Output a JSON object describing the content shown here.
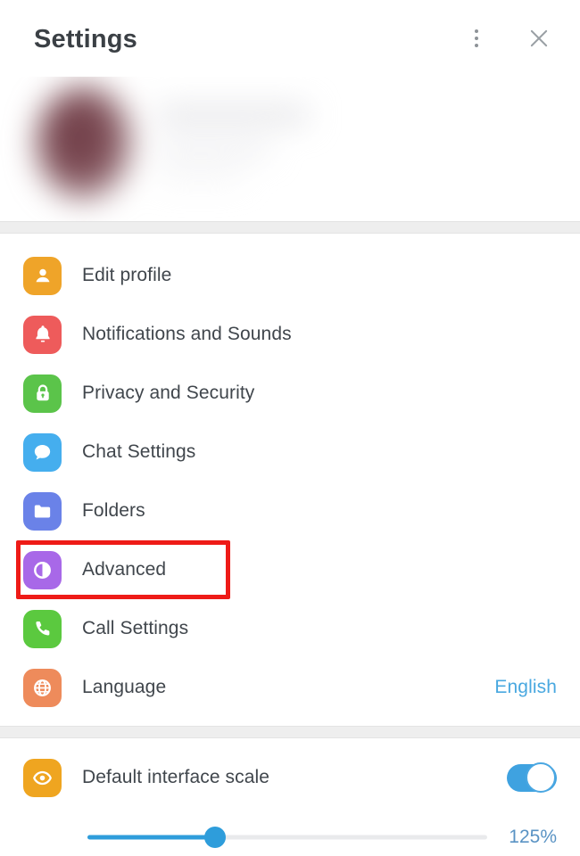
{
  "header": {
    "title": "Settings",
    "menu_icon": "more-vertical-icon",
    "close_icon": "close-icon"
  },
  "profile": {
    "blurred": true,
    "avatar_icon": "blurred-avatar"
  },
  "menu": {
    "items": [
      {
        "label": "Edit profile",
        "icon": "person-icon",
        "color": "#efa429",
        "value": ""
      },
      {
        "label": "Notifications and Sounds",
        "icon": "bell-icon",
        "color": "#ee5b5b",
        "value": ""
      },
      {
        "label": "Privacy and Security",
        "icon": "lock-icon",
        "color": "#5bc44a",
        "value": ""
      },
      {
        "label": "Chat Settings",
        "icon": "chat-bubble-icon",
        "color": "#45aeee",
        "value": ""
      },
      {
        "label": "Folders",
        "icon": "folder-icon",
        "color": "#6a82e8",
        "value": ""
      },
      {
        "label": "Advanced",
        "icon": "contrast-icon",
        "color": "#a868e8",
        "value": ""
      },
      {
        "label": "Call Settings",
        "icon": "phone-icon",
        "color": "#5bc93f",
        "value": ""
      },
      {
        "label": "Language",
        "icon": "globe-icon",
        "color": "#ee8b5b",
        "value": "English"
      }
    ]
  },
  "highlight": {
    "target_label": "Advanced",
    "color": "#ee1b17"
  },
  "scale": {
    "label": "Default interface scale",
    "icon": "eye-icon",
    "icon_color": "#efa520",
    "toggle_on": true,
    "toggle_color": "#3fa2e0",
    "value_label": "125%",
    "slider_percent": 32
  }
}
